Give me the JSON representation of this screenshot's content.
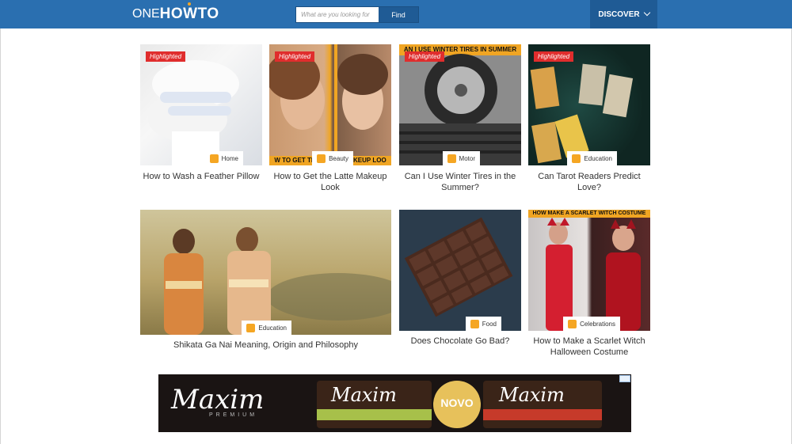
{
  "header": {
    "logo_one": "ONE",
    "logo_how": "HOWTO",
    "search_placeholder": "What are you looking for",
    "search_button": "Find",
    "discover_label": "DISCOVER"
  },
  "cards": [
    {
      "title": "How to Wash a Feather Pillow",
      "category": "Home",
      "highlighted": "Highlighted"
    },
    {
      "title": "How to Get the Latte Makeup Look",
      "category": "Beauty",
      "highlighted": "Highlighted",
      "strip": "W TO GET THE LATTE MAKEUP LOO"
    },
    {
      "title": "Can I Use Winter Tires in the Summer?",
      "category": "Motor",
      "highlighted": "Highlighted",
      "strip": "AN I USE WINTER TIRES IN SUMMER"
    },
    {
      "title": "Can Tarot Readers Predict Love?",
      "category": "Education",
      "highlighted": "Highlighted"
    },
    {
      "title": "Shikata Ga Nai Meaning, Origin and Philosophy",
      "category": "Education"
    },
    {
      "title": "Does Chocolate Go Bad?",
      "category": "Food"
    },
    {
      "title": "How to Make a Scarlet Witch Halloween Costume",
      "category": "Celebrations",
      "strip": "HOW MAKE A SCARLET WITCH COSTUME"
    }
  ],
  "ad": {
    "brand": "Maxim",
    "sub": "PREMIUM",
    "novo": "NOVO"
  },
  "colors": {
    "header_blue": "#2a6fb0",
    "header_dark": "#1f5b95",
    "highlight_red": "#e02d2d",
    "accent_orange": "#f5a623"
  }
}
